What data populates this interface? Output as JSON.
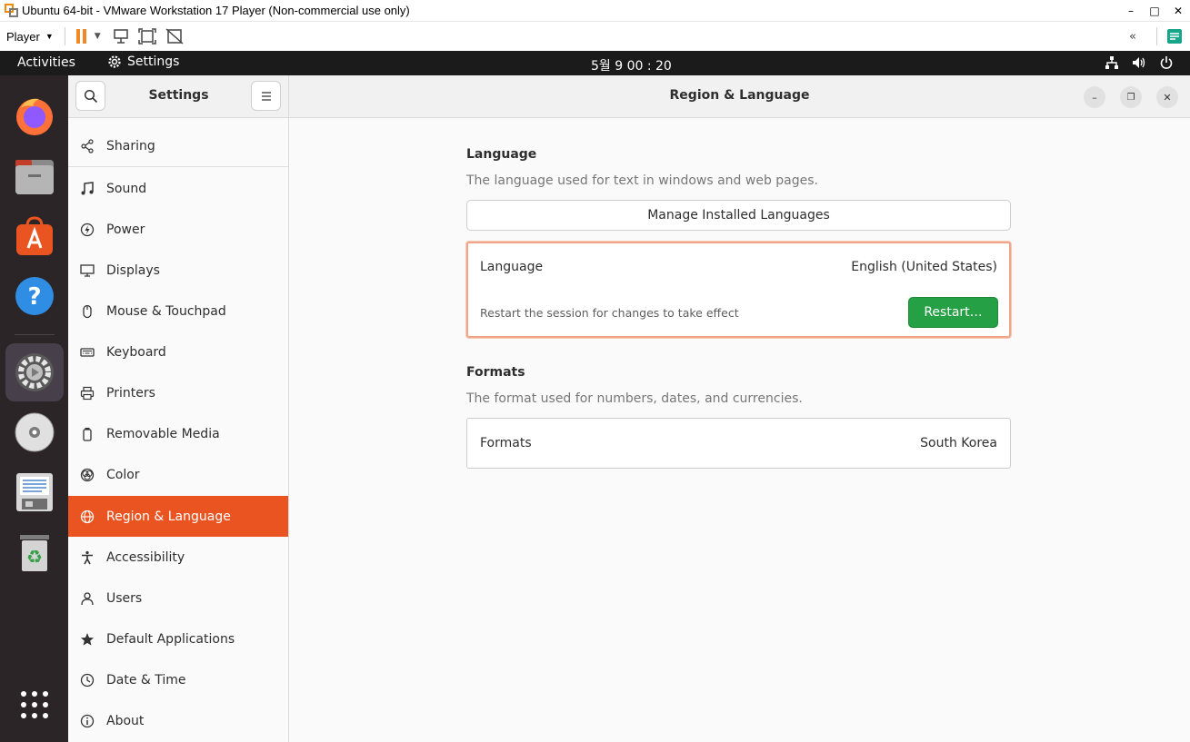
{
  "vmware": {
    "title": "Ubuntu 64-bit - VMware Workstation 17 Player (Non-commercial use only)",
    "player_menu": "Player",
    "icons": [
      "vmware-logo-icon",
      "pause-icon",
      "send-ctrl-alt-del-icon",
      "fit-window-icon",
      "unity-icon",
      "collapse-toolbar-icon",
      "notes-icon"
    ]
  },
  "topbar": {
    "activities": "Activities",
    "app_name": "Settings",
    "clock": "5월 9  00 : 20",
    "tray_icons": [
      "network-icon",
      "volume-icon",
      "power-icon"
    ]
  },
  "dock": {
    "items": [
      "Firefox",
      "Files",
      "Ubuntu Software",
      "Help",
      "Settings",
      "Disc",
      "Text Editor",
      "Trash",
      "Show Applications"
    ],
    "active": "Settings"
  },
  "sidebar": {
    "title": "Settings",
    "items": [
      {
        "label": "Sharing",
        "icon": "share-icon"
      },
      {
        "label": "Sound",
        "icon": "music-note-icon"
      },
      {
        "label": "Power",
        "icon": "power-icon"
      },
      {
        "label": "Displays",
        "icon": "display-icon"
      },
      {
        "label": "Mouse & Touchpad",
        "icon": "mouse-icon"
      },
      {
        "label": "Keyboard",
        "icon": "keyboard-icon"
      },
      {
        "label": "Printers",
        "icon": "printer-icon"
      },
      {
        "label": "Removable Media",
        "icon": "removable-media-icon"
      },
      {
        "label": "Color",
        "icon": "color-icon"
      },
      {
        "label": "Region & Language",
        "icon": "globe-icon"
      },
      {
        "label": "Accessibility",
        "icon": "accessibility-icon"
      },
      {
        "label": "Users",
        "icon": "users-icon"
      },
      {
        "label": "Default Applications",
        "icon": "star-icon"
      },
      {
        "label": "Date & Time",
        "icon": "clock-icon"
      },
      {
        "label": "About",
        "icon": "info-icon"
      }
    ],
    "selected": "Region & Language"
  },
  "main": {
    "title": "Region & Language",
    "language_section": {
      "title": "Language",
      "description": "The language used for text in windows and web pages.",
      "manage_button": "Manage Installed Languages",
      "row_label": "Language",
      "row_value": "English (United States)",
      "restart_note": "Restart the session for changes to take effect",
      "restart_button": "Restart…"
    },
    "formats_section": {
      "title": "Formats",
      "description": "The format used for numbers, dates, and currencies.",
      "row_label": "Formats",
      "row_value": "South Korea"
    }
  },
  "colors": {
    "accent": "#e95420",
    "restart_green": "#26a044",
    "dock_bg": "#2b2528",
    "topbar_bg": "#1b1b1b"
  }
}
